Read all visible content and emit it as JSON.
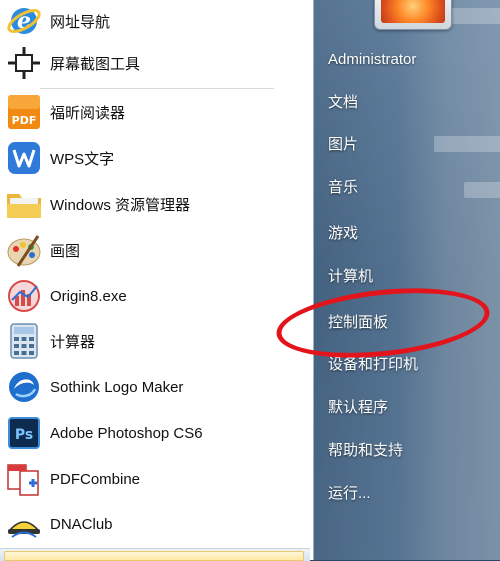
{
  "pinned": [
    {
      "label": "网址导航",
      "icon": "ie-browser-icon"
    },
    {
      "label": "屏幕截图工具",
      "icon": "screenshot-crosshair-icon"
    }
  ],
  "recent": [
    {
      "label": "福昕阅读器",
      "icon": "foxit-pdf-icon"
    },
    {
      "label": "WPS文字",
      "icon": "wps-writer-icon"
    },
    {
      "label": "Windows 资源管理器",
      "icon": "folder-explorer-icon"
    },
    {
      "label": "画图",
      "icon": "paint-palette-icon"
    },
    {
      "label": "Origin8.exe",
      "icon": "origin-app-icon"
    },
    {
      "label": "计算器",
      "icon": "calculator-icon"
    },
    {
      "label": "Sothink Logo Maker",
      "icon": "sothink-logo-icon"
    },
    {
      "label": "Adobe Photoshop CS6",
      "icon": "photoshop-icon"
    },
    {
      "label": "PDFCombine",
      "icon": "pdf-combine-icon"
    },
    {
      "label": "DNAClub",
      "icon": "dnaclub-icon"
    }
  ],
  "right_menu": [
    {
      "label": "Administrator"
    },
    {
      "label": "文档"
    },
    {
      "label": "图片"
    },
    {
      "label": "音乐"
    },
    {
      "label": "游戏"
    },
    {
      "label": "计算机"
    },
    {
      "label": "控制面板"
    },
    {
      "label": "设备和打印机"
    },
    {
      "label": "默认程序"
    },
    {
      "label": "帮助和支持"
    },
    {
      "label": "运行..."
    }
  ],
  "colors": {
    "highlight_ellipse": "#e3141b",
    "right_text": "#ffffff"
  }
}
